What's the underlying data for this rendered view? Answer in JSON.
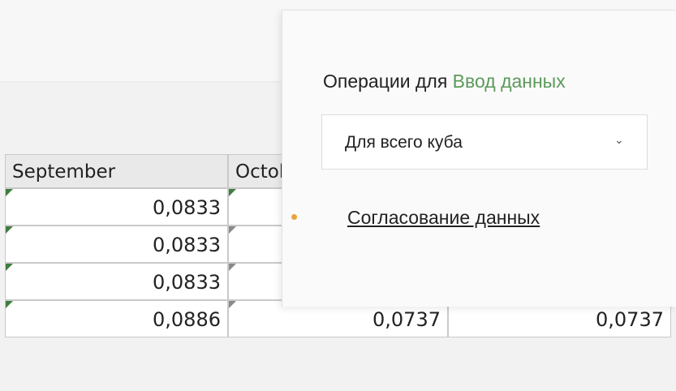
{
  "sheet": {
    "columns": [
      "September",
      "October"
    ],
    "rows": [
      {
        "september": "0,0833"
      },
      {
        "september": "0,0833"
      },
      {
        "september": "0,0833"
      },
      {
        "september": "0,0886",
        "october": "0,0737",
        "next": "0,0737"
      }
    ]
  },
  "popup": {
    "title_prefix": "Операции для",
    "title_highlight": "Ввод данных",
    "scope_select": {
      "value": "Для всего куба"
    },
    "action_link": "Согласование данных"
  },
  "colors": {
    "highlight": "#5b9a5a",
    "dot": "#e8a43a",
    "cell_marker": "#3f7d3f"
  }
}
